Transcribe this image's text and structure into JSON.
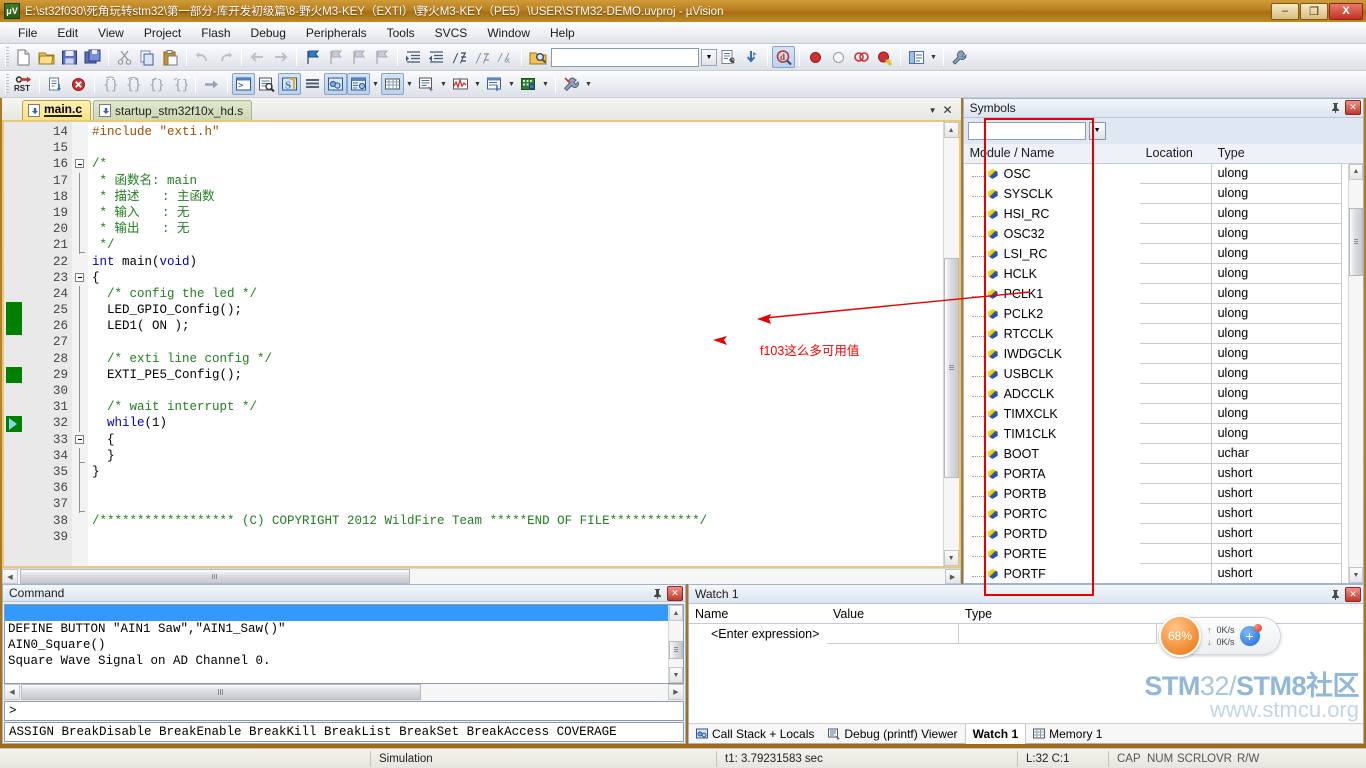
{
  "window": {
    "title": "E:\\st32f030\\死角玩转stm32\\第一部分-库开发初级篇\\8-野火M3-KEY（EXTI）\\野火M3-KEY（PE5）\\USER\\STM32-DEMO.uvproj - µVision",
    "logo": "uv-logo",
    "minimize": "–",
    "maximize": "❐",
    "close": "X"
  },
  "menu": {
    "items": [
      "File",
      "Edit",
      "View",
      "Project",
      "Flash",
      "Debug",
      "Peripherals",
      "Tools",
      "SVCS",
      "Window",
      "Help"
    ]
  },
  "toolbar1": {
    "search_value": "",
    "search_placeholder": ""
  },
  "editor": {
    "tabs": [
      {
        "label": "main.c",
        "active": true
      },
      {
        "label": "startup_stm32f10x_hd.s",
        "active": false
      }
    ],
    "close_icon": "✕",
    "dropdown_icon": "▼",
    "lines": [
      {
        "n": 14,
        "segments": [
          {
            "t": "#include ",
            "c": "pp"
          },
          {
            "t": "\"exti.h\"",
            "c": "str"
          }
        ]
      },
      {
        "n": 15,
        "segments": []
      },
      {
        "n": 16,
        "segments": [
          {
            "t": "/*",
            "c": "cmt"
          }
        ],
        "fold": "start"
      },
      {
        "n": 17,
        "segments": [
          {
            "t": " * 函数名: main",
            "c": "cmt"
          }
        ],
        "fold": "mid"
      },
      {
        "n": 18,
        "segments": [
          {
            "t": " * 描述   : 主函数",
            "c": "cmt"
          }
        ],
        "fold": "mid"
      },
      {
        "n": 19,
        "segments": [
          {
            "t": " * 输入   : 无",
            "c": "cmt"
          }
        ],
        "fold": "mid"
      },
      {
        "n": 20,
        "segments": [
          {
            "t": " * 输出   : 无",
            "c": "cmt"
          }
        ],
        "fold": "mid"
      },
      {
        "n": 21,
        "segments": [
          {
            "t": " */",
            "c": "cmt"
          }
        ],
        "fold": "end"
      },
      {
        "n": 22,
        "segments": [
          {
            "t": "int",
            "c": "kw"
          },
          {
            "t": " main(",
            "c": "plain"
          },
          {
            "t": "void",
            "c": "kw"
          },
          {
            "t": ")",
            "c": "plain"
          }
        ]
      },
      {
        "n": 23,
        "segments": [
          {
            "t": "{",
            "c": "plain"
          }
        ],
        "fold": "start"
      },
      {
        "n": 24,
        "segments": [
          {
            "t": "  /* config the led */",
            "c": "cmt"
          }
        ],
        "fold": "mid"
      },
      {
        "n": 25,
        "segments": [
          {
            "t": "  LED_GPIO_Config();",
            "c": "plain"
          }
        ],
        "fold": "mid",
        "marker": "green"
      },
      {
        "n": 26,
        "segments": [
          {
            "t": "  LED1( ON );",
            "c": "plain"
          }
        ],
        "fold": "mid",
        "marker": "green"
      },
      {
        "n": 27,
        "segments": [],
        "fold": "mid"
      },
      {
        "n": 28,
        "segments": [
          {
            "t": "  /* exti line config */",
            "c": "cmt"
          }
        ],
        "fold": "mid"
      },
      {
        "n": 29,
        "segments": [
          {
            "t": "  EXTI_PE5_Config();",
            "c": "plain"
          }
        ],
        "fold": "mid",
        "marker": "green"
      },
      {
        "n": 30,
        "segments": [],
        "fold": "mid"
      },
      {
        "n": 31,
        "segments": [
          {
            "t": "  /* wait interrupt */",
            "c": "cmt"
          }
        ],
        "fold": "mid"
      },
      {
        "n": 32,
        "segments": [
          {
            "t": "  while",
            "c": "kw"
          },
          {
            "t": "(1)",
            "c": "plain"
          }
        ],
        "fold": "mid",
        "marker": "arrow"
      },
      {
        "n": 33,
        "segments": [
          {
            "t": "  {",
            "c": "plain"
          }
        ],
        "fold": "start2"
      },
      {
        "n": 34,
        "segments": [
          {
            "t": "  }",
            "c": "plain"
          }
        ],
        "fold": "end2"
      },
      {
        "n": 35,
        "segments": [
          {
            "t": "}",
            "c": "plain"
          }
        ],
        "fold": "mid"
      },
      {
        "n": 36,
        "segments": [],
        "fold": "mid"
      },
      {
        "n": 37,
        "segments": [],
        "fold": "end"
      },
      {
        "n": 38,
        "segments": [
          {
            "t": "/****************** (C) COPYRIGHT 2012 WildFire Team *****END OF FILE************/",
            "c": "cmt"
          }
        ]
      },
      {
        "n": 39,
        "segments": []
      }
    ]
  },
  "annotations": {
    "note_text": "f103这么多可用值"
  },
  "symbols": {
    "title": "Symbols",
    "pin_icon": "pin-icon",
    "close_icon": "✕",
    "filter_value": "",
    "filter_placeholder": "",
    "dropdown_icon": "▼",
    "columns": [
      "Module / Name",
      "Location",
      "Type"
    ],
    "rows": [
      {
        "name": "OSC",
        "location": "",
        "type": "ulong"
      },
      {
        "name": "SYSCLK",
        "location": "",
        "type": "ulong"
      },
      {
        "name": "HSI_RC",
        "location": "",
        "type": "ulong"
      },
      {
        "name": "OSC32",
        "location": "",
        "type": "ulong"
      },
      {
        "name": "LSI_RC",
        "location": "",
        "type": "ulong"
      },
      {
        "name": "HCLK",
        "location": "",
        "type": "ulong"
      },
      {
        "name": "PCLK1",
        "location": "",
        "type": "ulong"
      },
      {
        "name": "PCLK2",
        "location": "",
        "type": "ulong"
      },
      {
        "name": "RTCCLK",
        "location": "",
        "type": "ulong"
      },
      {
        "name": "IWDGCLK",
        "location": "",
        "type": "ulong"
      },
      {
        "name": "USBCLK",
        "location": "",
        "type": "ulong"
      },
      {
        "name": "ADCCLK",
        "location": "",
        "type": "ulong"
      },
      {
        "name": "TIMXCLK",
        "location": "",
        "type": "ulong"
      },
      {
        "name": "TIM1CLK",
        "location": "",
        "type": "ulong"
      },
      {
        "name": "BOOT",
        "location": "",
        "type": "uchar"
      },
      {
        "name": "PORTA",
        "location": "",
        "type": "ushort"
      },
      {
        "name": "PORTB",
        "location": "",
        "type": "ushort"
      },
      {
        "name": "PORTC",
        "location": "",
        "type": "ushort"
      },
      {
        "name": "PORTD",
        "location": "",
        "type": "ushort"
      },
      {
        "name": "PORTE",
        "location": "",
        "type": "ushort"
      },
      {
        "name": "PORTF",
        "location": "",
        "type": "ushort"
      }
    ]
  },
  "command": {
    "title": "Command",
    "pin_icon": "pin-icon",
    "close_icon": "✕",
    "output_lines": [
      "DEFINE BUTTON \"AIN1 Saw\",\"AIN1_Saw()\"",
      "AIN0_Square()",
      "Square Wave Signal on AD Channel 0."
    ],
    "prompt": ">",
    "input_value": "",
    "help_line": "ASSIGN BreakDisable BreakEnable BreakKill BreakList BreakSet BreakAccess COVERAGE"
  },
  "watch": {
    "title": "Watch 1",
    "pin_icon": "pin-icon",
    "close_icon": "✕",
    "columns": [
      "Name",
      "Value",
      "Type"
    ],
    "rows": [
      {
        "name": "<Enter expression>",
        "value": "",
        "type": ""
      }
    ],
    "tabs": [
      {
        "label": "Call Stack + Locals",
        "icon": "call-stack-icon",
        "active": false
      },
      {
        "label": "Debug (printf) Viewer",
        "icon": "printf-viewer-icon",
        "active": false
      },
      {
        "label": "Watch 1",
        "icon": "",
        "active": true
      },
      {
        "label": "Memory 1",
        "icon": "memory-icon",
        "active": false
      }
    ]
  },
  "speed_widget": {
    "percent": "68%",
    "upload": "0K/s",
    "download": "0K/s",
    "up_arrow": "↑",
    "down_arrow": "↓",
    "plus": "+"
  },
  "watermark": {
    "line1_a": "STM",
    "line1_b": "32/",
    "line1_c": "STM",
    "line1_d": "8社区",
    "line2": "www.stmcu.org"
  },
  "statusbar": {
    "mode": "Simulation",
    "time": "t1: 3.79231583 sec",
    "position": "L:32 C:1",
    "flags": [
      "CAP",
      "NUM",
      "SCRL",
      "OVR",
      "R/W"
    ]
  }
}
